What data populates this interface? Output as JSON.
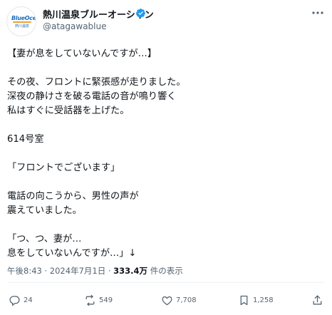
{
  "author": {
    "name": "熱川温泉ブルーオーシャン",
    "handle": "@atagawablue",
    "avatar_text": "BlueOcean",
    "avatar_subtext": "熱川温泉",
    "verified_color": "#1d9bf0"
  },
  "post": {
    "lines": [
      "【妻が息をしていないんですが…】",
      "",
      "その夜、フロントに緊張感が走りました。",
      "深夜の静けさを破る電話の音が鳴り響く",
      "私はすぐに受話器を上げた。",
      "",
      "614号室",
      "",
      "「フロントでございます」",
      "",
      "電話の向こうから、男性の声が",
      "震えていました。",
      "",
      "「つ、つ、妻が…",
      "息をしていないんですが…」↓"
    ]
  },
  "meta": {
    "time": "午後8:43",
    "date": "2024年7月1日",
    "separator": "·",
    "views": "333.4万",
    "views_suffix": "件の表示"
  },
  "actions": {
    "replies": "24",
    "reposts": "549",
    "likes": "7,708",
    "bookmarks": "1,258"
  },
  "icons": [
    "verified-icon",
    "more-icon",
    "reply-icon",
    "repost-icon",
    "like-icon",
    "bookmark-icon",
    "share-icon"
  ]
}
